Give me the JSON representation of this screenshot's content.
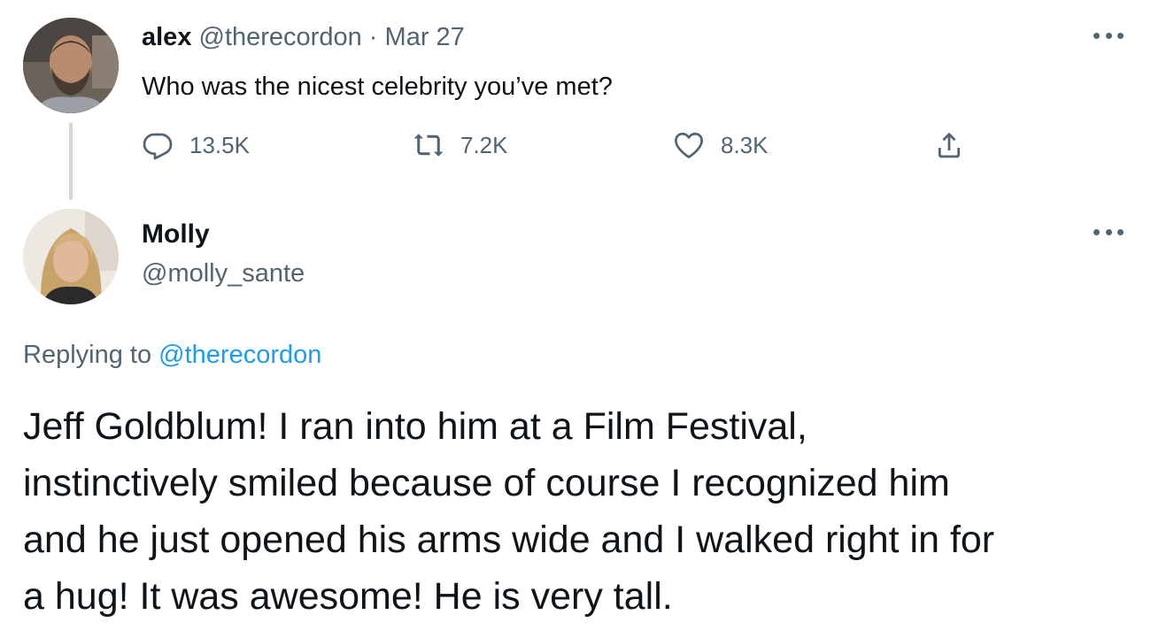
{
  "parent_tweet": {
    "display_name": "alex",
    "handle": "@therecordon",
    "separator": "·",
    "date": "Mar 27",
    "text": "Who was the nicest celebrity you’ve met?",
    "actions": {
      "reply_count": "13.5K",
      "retweet_count": "7.2K",
      "like_count": "8.3K"
    }
  },
  "reply_tweet": {
    "display_name": "Molly",
    "handle": "@molly_sante",
    "replying_prefix": "Replying to",
    "replying_to": "@therecordon",
    "body_lines": [
      "Jeff Goldblum! I ran into him at a Film Festival,",
      "instinctively smiled because of course I recognized him",
      "and he just opened his arms wide and I walked right in for",
      "a hug! It was awesome! He is very tall."
    ]
  },
  "icons": {
    "reply": "reply-icon",
    "retweet": "retweet-icon",
    "like": "heart-icon",
    "share": "share-icon",
    "more": "more-horizontal-icon"
  },
  "colors": {
    "text_primary": "#0f1419",
    "text_secondary": "#536471",
    "link": "#1d9bf0",
    "thread_line": "#cfd9de"
  }
}
